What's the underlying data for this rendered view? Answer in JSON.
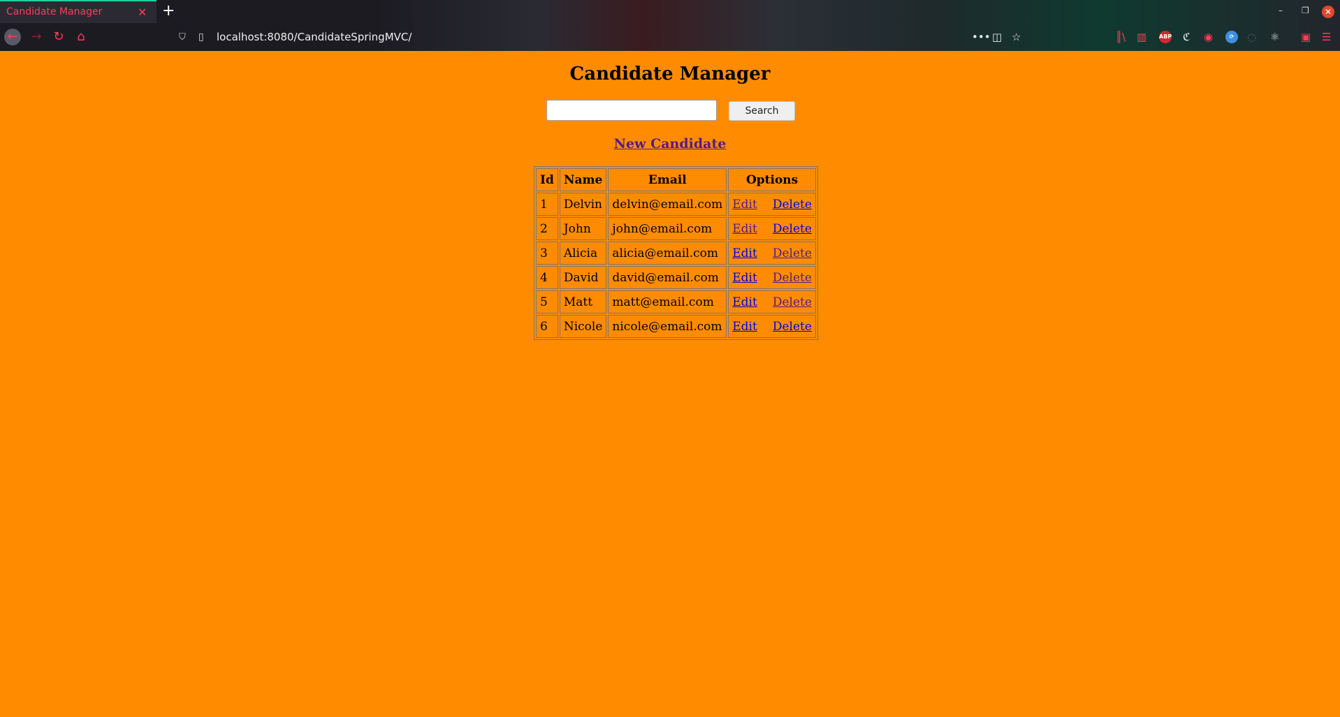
{
  "browser": {
    "tab_title": "Candidate Manager",
    "tab_close": "✕",
    "new_tab": "+",
    "url": "localhost:8080/CandidateSpringMVC/",
    "window_minimize": "–",
    "window_restore": "❐",
    "window_close": "✕",
    "icons": {
      "back": "back-arrow-icon",
      "forward": "forward-arrow-icon",
      "reload": "reload-icon",
      "home": "home-icon",
      "shield": "tracking-protection-icon",
      "page": "page-info-icon",
      "more": "more-icon",
      "pocket": "pocket-icon",
      "bookmark": "star-icon",
      "library": "library-icon",
      "sidebar": "sidebar-icon",
      "adblock": "abp-icon",
      "account": "account-icon",
      "react": "react-devtools-icon",
      "gift": "gift-icon",
      "menu": "hamburger-menu-icon"
    },
    "ext_abp": "ABP",
    "colors": {
      "accent": "#ff3c5a",
      "tab_highlight": "#1ed1a0"
    }
  },
  "page": {
    "title": "Candidate Manager",
    "search": {
      "value": "",
      "button_label": "Search"
    },
    "new_candidate_label": "New Candidate",
    "background": "#ff8c00",
    "table": {
      "headers": [
        "Id",
        "Name",
        "Email",
        "Options"
      ],
      "rows": [
        {
          "id": "1",
          "name": "Delvin",
          "email": "delvin@email.com",
          "edit": "Edit",
          "delete": "Delete"
        },
        {
          "id": "2",
          "name": "John",
          "email": "john@email.com",
          "edit": "Edit",
          "delete": "Delete"
        },
        {
          "id": "3",
          "name": "Alicia",
          "email": "alicia@email.com",
          "edit": "Edit",
          "delete": "Delete"
        },
        {
          "id": "4",
          "name": "David",
          "email": "david@email.com",
          "edit": "Edit",
          "delete": "Delete"
        },
        {
          "id": "5",
          "name": "Matt",
          "email": "matt@email.com",
          "edit": "Edit",
          "delete": "Delete"
        },
        {
          "id": "6",
          "name": "Nicole",
          "email": "nicole@email.com",
          "edit": "Edit",
          "delete": "Delete"
        }
      ]
    }
  }
}
